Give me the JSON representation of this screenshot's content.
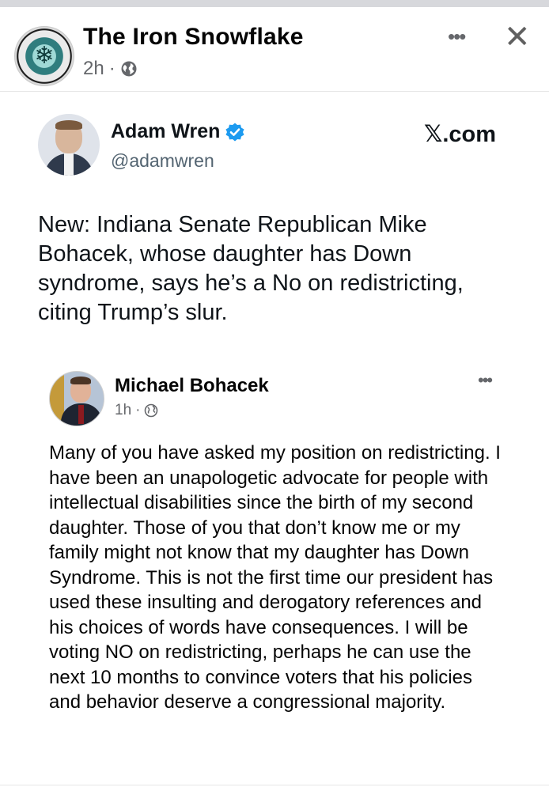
{
  "post": {
    "page_name": "The Iron Snowflake",
    "time": "2h",
    "separator": "·",
    "privacy_icon": "globe-icon",
    "more_icon": "more-horizontal-icon",
    "close_icon": "close-icon"
  },
  "tweet": {
    "author_name": "Adam Wren",
    "verified_icon": "verified-badge-icon",
    "handle": "@adamwren",
    "brand_logo": "𝕏",
    "brand_suffix": ".com",
    "text": "New: Indiana Senate Republican Mike Bohacek, whose daughter has Down syndrome, says he’s a No on redistricting, citing Trump’s slur."
  },
  "quoted_post": {
    "author_name": "Michael Bohacek",
    "time": "1h",
    "separator": "·",
    "privacy_icon": "globe-icon",
    "more_icon": "more-horizontal-icon",
    "text": "Many of you have asked my position on redistricting.  I have been an unapologetic advocate for people with intellectual disabilities since the birth of my second daughter.  Those of you that don’t know me or my family might not know that my daughter has Down Syndrome. This is not the first time our president has used these insulting and derogatory references and his choices of words have consequences.  I will be voting NO on redistricting, perhaps he can use the next 10 months to convince voters that his policies and behavior deserve a congressional majority."
  },
  "colors": {
    "page_background": "#ffffff",
    "primary_text": "#050505",
    "secondary_text": "#65676b",
    "verified_blue": "#1d9bf0",
    "top_bar": "#d7d8dc"
  }
}
